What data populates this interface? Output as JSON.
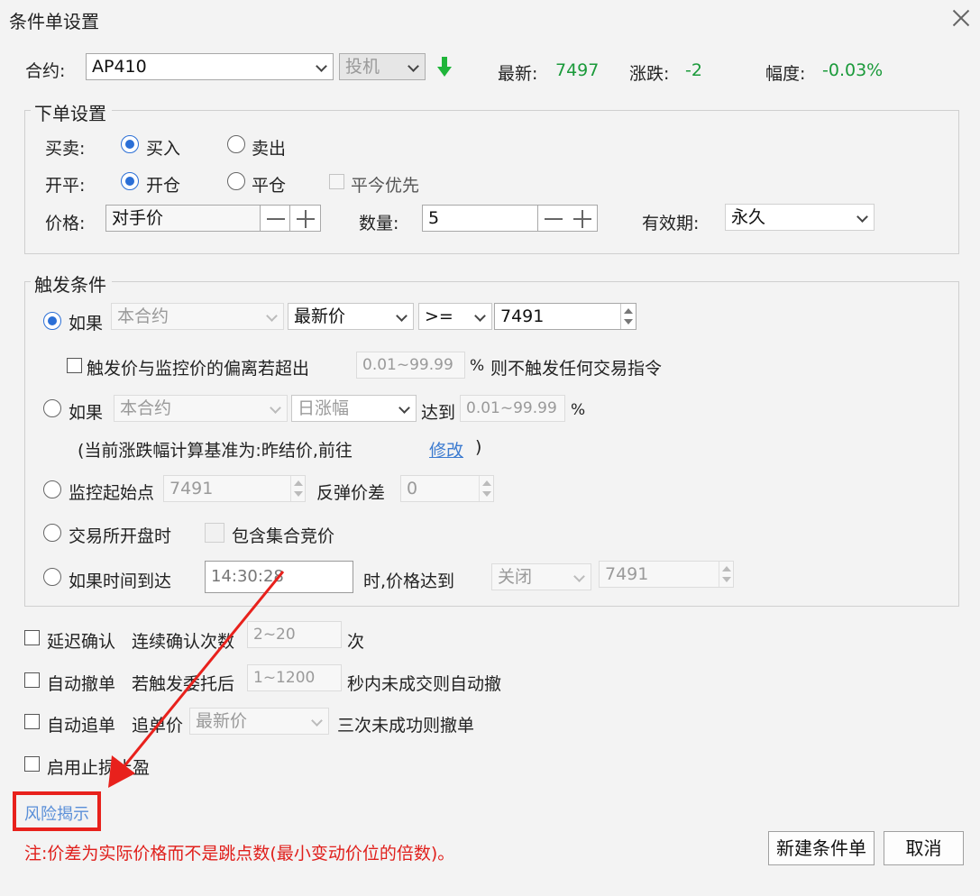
{
  "window": {
    "title": "条件单设置"
  },
  "contract": {
    "label": "合约:",
    "value": "AP410",
    "hedge_value": "投机",
    "latest_label": "最新:",
    "latest_value": "7497",
    "change_label": "涨跌:",
    "change_value": "-2",
    "range_label": "幅度:",
    "range_value": "-0.03%",
    "quote_color": "#1a9a3a"
  },
  "order": {
    "legend": "下单设置",
    "side_label": "买卖:",
    "buy": "买入",
    "sell": "卖出",
    "side_selected": "买入",
    "offset_label": "开平:",
    "open": "开仓",
    "close": "平仓",
    "offset_selected": "开仓",
    "close_today_first": "平今优先",
    "price_label": "价格:",
    "price_value": "对手价",
    "qty_label": "数量:",
    "qty_value": "5",
    "valid_label": "有效期:",
    "valid_value": "永久"
  },
  "trigger": {
    "legend": "触发条件",
    "c1_if": "如果",
    "c1_contract": "本合约",
    "c1_field": "最新价",
    "c1_op": ">=",
    "c1_value": "7491",
    "dev_text": "触发价与监控价的偏离若超出",
    "dev_placeholder": "0.01~99.99",
    "dev_pct": "%",
    "dev_suffix": "则不触发任何交易指令",
    "c2_if": "如果",
    "c2_contract": "本合约",
    "c2_field": "日涨幅",
    "c2_reach": "达到",
    "c2_placeholder": "0.01~99.99",
    "c2_pct": "%",
    "basis_text": "(当前涨跌幅计算基准为:昨结价,前往",
    "basis_link": "修改",
    "basis_close": ")",
    "c3_label": "监控起始点",
    "c3_value": "7491",
    "c3_rebound_label": "反弹价差",
    "c3_rebound_value": "0",
    "c4_label": "交易所开盘时",
    "c4_include": "包含集合竞价",
    "c5_label": "如果时间到达",
    "c5_time": "14:30:28",
    "c5_mid": "时,价格达到",
    "c5_state": "关闭",
    "c5_price": "7491",
    "selected": "c1"
  },
  "options": {
    "delay_label": "延迟确认",
    "delay_text": "连续确认次数",
    "delay_placeholder": "2~20",
    "delay_unit": "次",
    "cancel_label": "自动撤单",
    "cancel_text": "若触发委托后",
    "cancel_placeholder": "1~1200",
    "cancel_suffix": "秒内未成交则自动撤",
    "chase_label": "自动追单",
    "chase_text": "追单价",
    "chase_value": "最新价",
    "chase_suffix": "三次未成功则撤单",
    "stop_label": "启用止损止盈"
  },
  "footer": {
    "risk_link": "风险揭示",
    "note": "注:价差为实际价格而不是跳点数(最小变动价位的倍数)。",
    "new_button": "新建条件单",
    "cancel_button": "取消",
    "highlight_color": "#e8211c"
  }
}
